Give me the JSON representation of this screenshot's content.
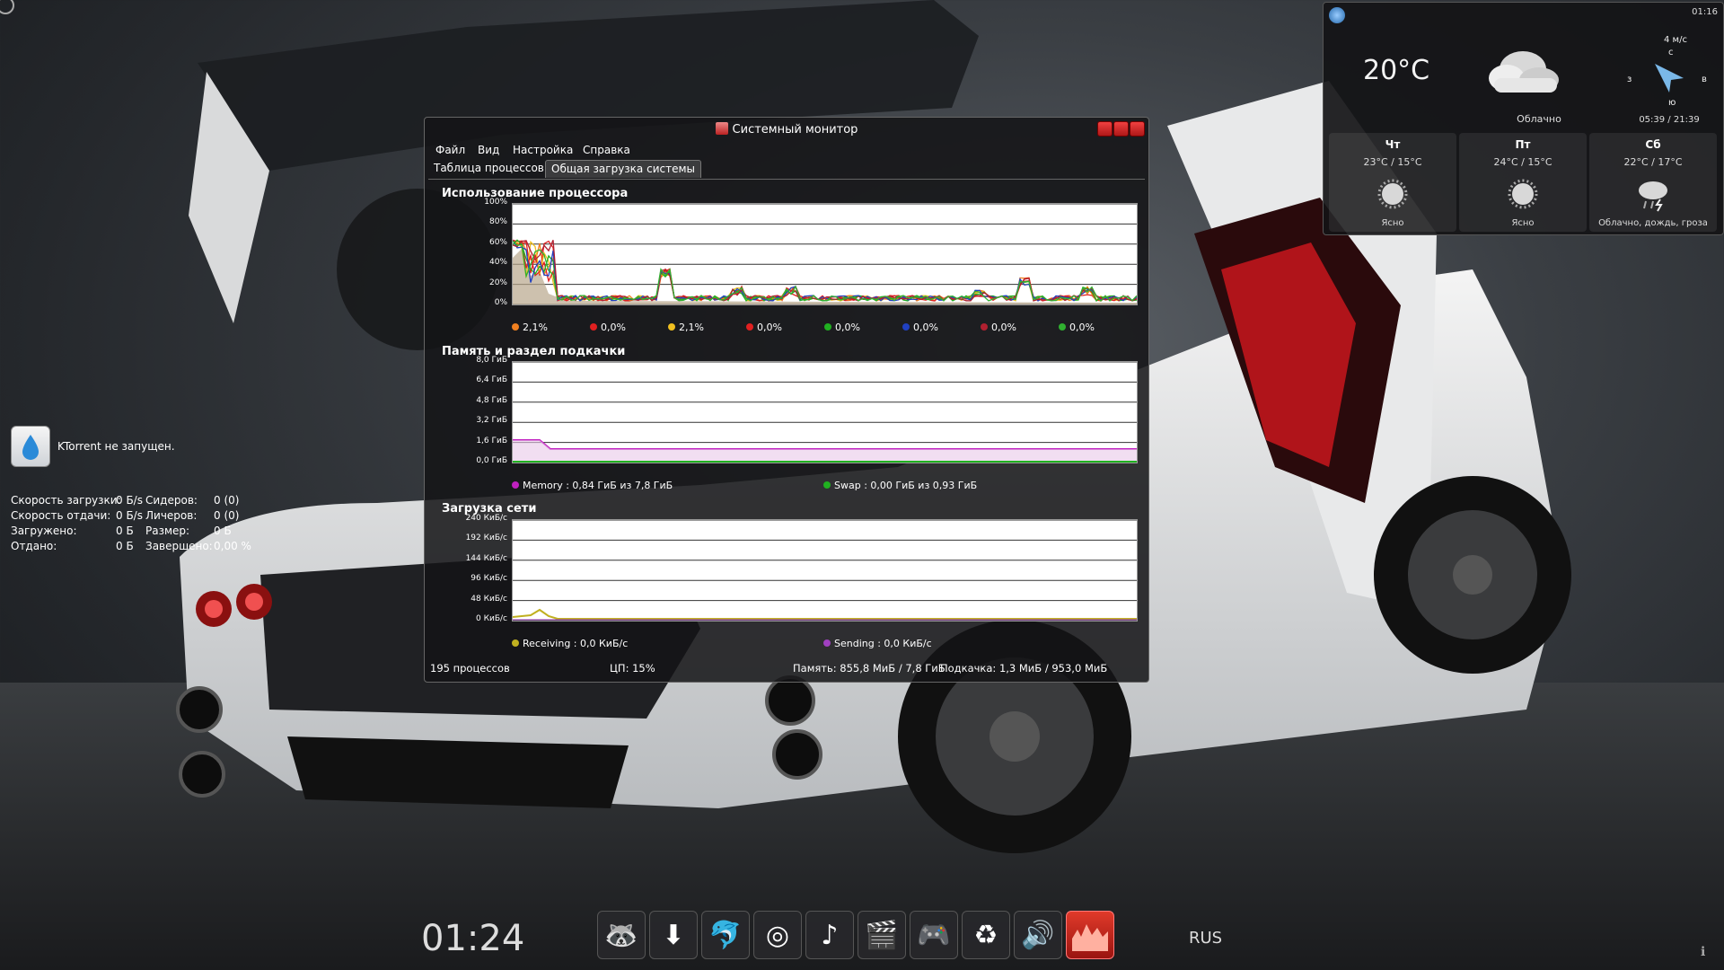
{
  "weather": {
    "time": "01:16",
    "current_temp": "20°C",
    "condition": "Облачно",
    "wind_speed": "4 м/с",
    "compass": {
      "n": "с",
      "s": "ю",
      "w": "з",
      "e": "в"
    },
    "sunrise_sunset": "05:39 / 21:39",
    "forecast": [
      {
        "day": "Чт",
        "temps": "23°C / 15°C",
        "desc": "Ясно",
        "icon": "sun-icon"
      },
      {
        "day": "Пт",
        "temps": "24°C / 15°C",
        "desc": "Ясно",
        "icon": "sun-icon"
      },
      {
        "day": "Сб",
        "temps": "22°C / 17°C",
        "desc": "Облачно, дождь, гроза",
        "icon": "storm-icon"
      }
    ]
  },
  "ktorrent": {
    "status": "KTorrent не запущен.",
    "rows": [
      {
        "l1": "Скорость загрузки:",
        "v1": "0 Б/s",
        "l2": "Сидеров:",
        "v2": "0 (0)"
      },
      {
        "l1": "Скорость отдачи:",
        "v1": "0 Б/s",
        "l2": "Личеров:",
        "v2": "0 (0)"
      },
      {
        "l1": "Загружено:",
        "v1": "0 Б",
        "l2": "Размер:",
        "v2": "0 Б"
      },
      {
        "l1": "Отдано:",
        "v1": "0 Б",
        "l2": "Завершено:",
        "v2": "0,00 %"
      }
    ]
  },
  "sysmon": {
    "title": "Системный монитор",
    "menu": [
      "Файл",
      "Вид",
      "Настройка",
      "Справка"
    ],
    "tabs": [
      "Таблица процессов",
      "Общая загрузка системы"
    ],
    "cpu": {
      "title": "Использование процессора",
      "yticks": [
        "100%",
        "80%",
        "60%",
        "40%",
        "20%",
        "0%"
      ],
      "legend": [
        {
          "color": "#f08020",
          "value": "2,1%"
        },
        {
          "color": "#e02020",
          "value": "0,0%"
        },
        {
          "color": "#f0c020",
          "value": "2,1%"
        },
        {
          "color": "#e02020",
          "value": "0,0%"
        },
        {
          "color": "#20b020",
          "value": "0,0%"
        },
        {
          "color": "#2040c0",
          "value": "0,0%"
        },
        {
          "color": "#b02030",
          "value": "0,0%"
        },
        {
          "color": "#30b030",
          "value": "0,0%"
        }
      ]
    },
    "memory": {
      "title": "Память и раздел подкачки",
      "yticks": [
        "8,0 ГиБ",
        "6,4 ГиБ",
        "4,8 ГиБ",
        "3,2 ГиБ",
        "1,6 ГиБ",
        "0,0 ГиБ"
      ],
      "memory_label": "Memory : 0,84 ГиБ из 7,8 ГиБ",
      "swap_label": "Swap : 0,00 ГиБ из 0,93 ГиБ",
      "memory_color": "#c020c0",
      "swap_color": "#20b020"
    },
    "network": {
      "title": "Загрузка сети",
      "yticks": [
        "240 КиБ/с",
        "192 КиБ/с",
        "144 КиБ/с",
        "96 КиБ/с",
        "48 КиБ/с",
        "0 КиБ/с"
      ],
      "receiving_label": "Receiving : 0,0 КиБ/с",
      "sending_label": "Sending : 0,0 КиБ/с",
      "receiving_color": "#c0b020",
      "sending_color": "#a040c0"
    },
    "status": {
      "processes": "195 процессов",
      "cpu": "ЦП: 15%",
      "memory": "Память: 855,8 МиБ / 7,8 ГиБ",
      "swap": "Подкачка: 1,3 МиБ / 953,0 МиБ"
    }
  },
  "panel": {
    "clock": "01:24",
    "language": "RUS",
    "dock": [
      {
        "name": "raccoon-app-icon",
        "glyph": "🦝"
      },
      {
        "name": "download-icon",
        "glyph": "⬇"
      },
      {
        "name": "dolphin-icon",
        "glyph": "🐬"
      },
      {
        "name": "disc-icon",
        "glyph": "◎"
      },
      {
        "name": "music-note-icon",
        "glyph": "♪"
      },
      {
        "name": "clapperboard-icon",
        "glyph": "🎬"
      },
      {
        "name": "gamepad-icon",
        "glyph": "🎮"
      },
      {
        "name": "recycle-icon",
        "glyph": "♻"
      },
      {
        "name": "volume-icon",
        "glyph": "🔊"
      },
      {
        "name": "system-monitor-icon",
        "glyph": ""
      }
    ]
  }
}
